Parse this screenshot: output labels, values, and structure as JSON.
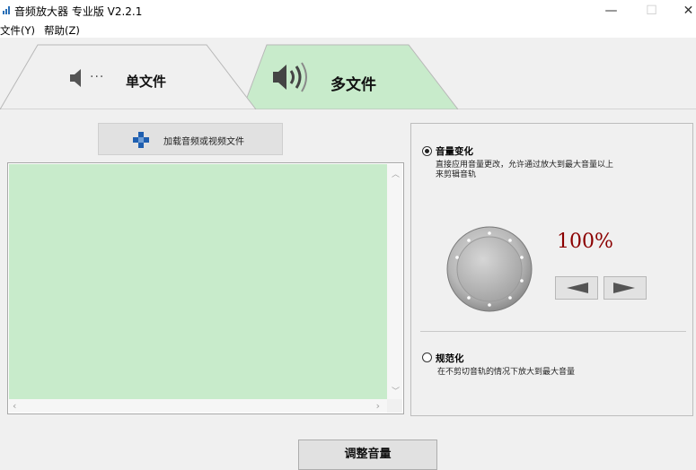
{
  "window": {
    "title": "音频放大器 专业版 V2.2.1",
    "minimize": "—",
    "maximize": "☐",
    "close": "✕"
  },
  "menu": [
    "文件(Y)",
    "帮助(Z)"
  ],
  "tabs": [
    {
      "label": "单文件",
      "icon": "speaker-low-icon",
      "active": true
    },
    {
      "label": "多文件",
      "icon": "speaker-loud-icon",
      "active": false
    }
  ],
  "colors": {
    "active_tab": "#f0f0f0",
    "inactive_tab": "#c8ebcb",
    "file_list_bg": "#c8ebcb",
    "percent_text": "#8b0000"
  },
  "load_button": {
    "label": "加载音频或视频文件",
    "icon": "plus-icon"
  },
  "options": {
    "volume_change": {
      "title": "音量变化",
      "desc_line1": "直接应用音量更改，允许通过放大到最大音量以上",
      "desc_line2": "来剪辑音轨",
      "selected": true
    },
    "normalize": {
      "title": "规范化",
      "desc": "在不剪切音轨的情况下放大到最大音量",
      "selected": false
    }
  },
  "volume": {
    "percent": "100%",
    "level": 1.0
  },
  "adjust_button": {
    "label": "调整音量"
  }
}
